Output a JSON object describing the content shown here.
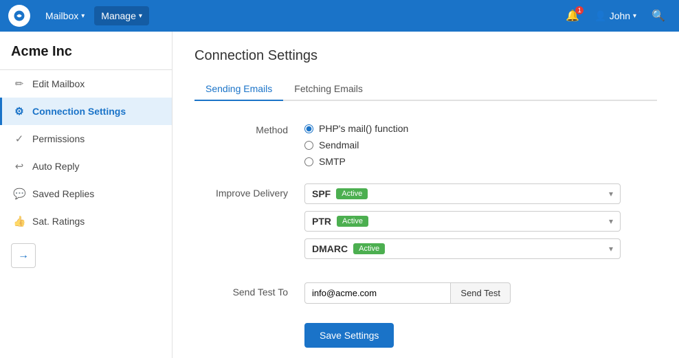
{
  "topNav": {
    "mailbox_label": "Mailbox",
    "manage_label": "Manage",
    "user_label": "John",
    "bell_icon": "🔔",
    "user_icon": "👤",
    "search_icon": "🔍"
  },
  "sidebar": {
    "company_name": "Acme Inc",
    "items": [
      {
        "id": "edit-mailbox",
        "label": "Edit Mailbox",
        "icon": "✏",
        "active": false
      },
      {
        "id": "connection-settings",
        "label": "Connection Settings",
        "icon": "⚙",
        "active": true
      },
      {
        "id": "permissions",
        "label": "Permissions",
        "icon": "✓",
        "active": false
      },
      {
        "id": "auto-reply",
        "label": "Auto Reply",
        "icon": "↩",
        "active": false
      },
      {
        "id": "saved-replies",
        "label": "Saved Replies",
        "icon": "💬",
        "active": false
      },
      {
        "id": "sat-ratings",
        "label": "Sat. Ratings",
        "icon": "👍",
        "active": false
      }
    ],
    "back_arrow": "→"
  },
  "main": {
    "page_title": "Connection Settings",
    "tabs": [
      {
        "id": "sending",
        "label": "Sending Emails",
        "active": true
      },
      {
        "id": "fetching",
        "label": "Fetching Emails",
        "active": false
      }
    ],
    "method_label": "Method",
    "method_options": [
      {
        "id": "php-mail",
        "label": "PHP's mail() function",
        "selected": true
      },
      {
        "id": "sendmail",
        "label": "Sendmail",
        "selected": false
      },
      {
        "id": "smtp",
        "label": "SMTP",
        "selected": false
      }
    ],
    "improve_delivery_label": "Improve Delivery",
    "delivery_options": [
      {
        "id": "spf",
        "name": "SPF",
        "status": "Active"
      },
      {
        "id": "ptr",
        "name": "PTR",
        "status": "Active"
      },
      {
        "id": "dmarc",
        "name": "DMARC",
        "status": "Active"
      }
    ],
    "send_test_label": "Send Test To",
    "send_test_placeholder": "info@acme.com",
    "send_test_btn_label": "Send Test",
    "save_btn_label": "Save Settings"
  }
}
